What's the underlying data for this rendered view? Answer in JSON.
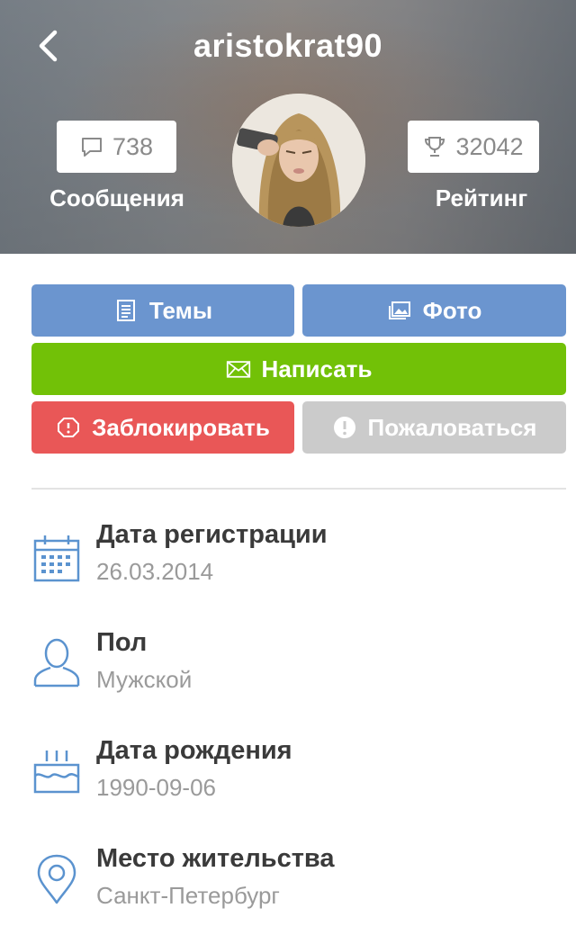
{
  "header": {
    "username": "aristokrat90",
    "messages": {
      "count": "738",
      "label": "Сообщения"
    },
    "rating": {
      "count": "32042",
      "label": "Рейтинг"
    }
  },
  "actions": {
    "topics": "Темы",
    "photo": "Фото",
    "write": "Написать",
    "block": "Заблокировать",
    "report": "Пожаловаться"
  },
  "info": [
    {
      "title": "Дата регистрации",
      "value": "26.03.2014",
      "icon": "calendar-icon"
    },
    {
      "title": "Пол",
      "value": "Мужской",
      "icon": "user-icon"
    },
    {
      "title": "Дата рождения",
      "value": "1990-09-06",
      "icon": "birthday-cake-icon"
    },
    {
      "title": "Место жительства",
      "value": "Санкт-Петербург",
      "icon": "location-pin-icon"
    }
  ],
  "colors": {
    "blue_button": "#6b95cf",
    "green_button": "#72c107",
    "red_button": "#e95757",
    "gray_button": "#cbcbcb",
    "icon_blue": "#5b93cf"
  }
}
